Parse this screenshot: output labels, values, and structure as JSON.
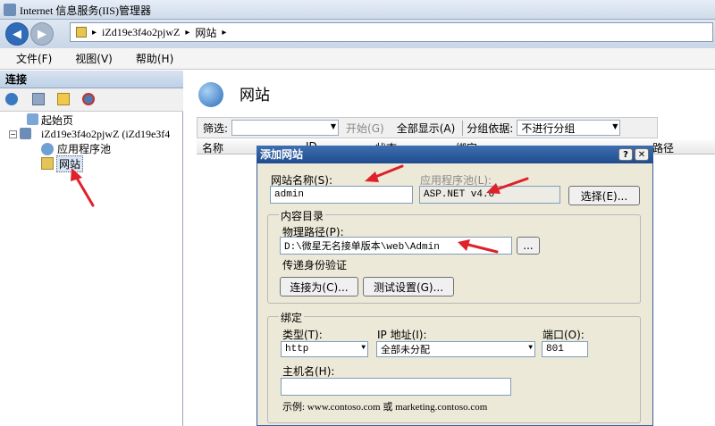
{
  "window": {
    "title": "Internet 信息服务(IIS)管理器"
  },
  "address": {
    "host": "iZd19e3f4o2pjwZ",
    "sep1": "▸",
    "sep2": "▸",
    "sep3": "▸",
    "page": "网站"
  },
  "menu": {
    "file": "文件(F)",
    "view": "视图(V)",
    "help": "帮助(H)"
  },
  "connections": {
    "header": "连接",
    "tree": {
      "start": "起始页",
      "server": "iZd19e3f4o2pjwZ (iZd19e3f4",
      "apppool": "应用程序池",
      "sites": "网站"
    }
  },
  "main": {
    "title": "网站",
    "filter": {
      "label": "筛选:",
      "start": "开始(G)",
      "showall": "全部显示(A)",
      "groupby": "分组依据:",
      "group_value": "不进行分组"
    },
    "columns": [
      "名称",
      "ID",
      "状态",
      "绑定",
      "路径"
    ]
  },
  "dialog": {
    "title": "添加网站",
    "help": "?",
    "close": "✕",
    "site_name_label": "网站名称(S):",
    "site_name_value": "admin",
    "apppool_label": "应用程序池(L):",
    "apppool_value": "ASP.NET v4.0",
    "select_button": "选择(E)...",
    "content_group": "内容目录",
    "physical_path_label": "物理路径(P):",
    "physical_path_value": "D:\\微星无名接单版本\\web\\Admin",
    "browse_button": "...",
    "pass_auth": "传递身份验证",
    "connect_as": "连接为(C)...",
    "test_settings": "测试设置(G)...",
    "binding_group": "绑定",
    "type_label": "类型(T):",
    "type_value": "http",
    "ip_label": "IP 地址(I):",
    "ip_value": "全部未分配",
    "port_label": "端口(O):",
    "port_value": "801",
    "host_label": "主机名(H):",
    "host_value": "",
    "example": "示例: www.contoso.com 或 marketing.contoso.com"
  },
  "colors": {
    "annotation_arrow": "#e0202a",
    "dialog_title": "#2a5a9d"
  }
}
